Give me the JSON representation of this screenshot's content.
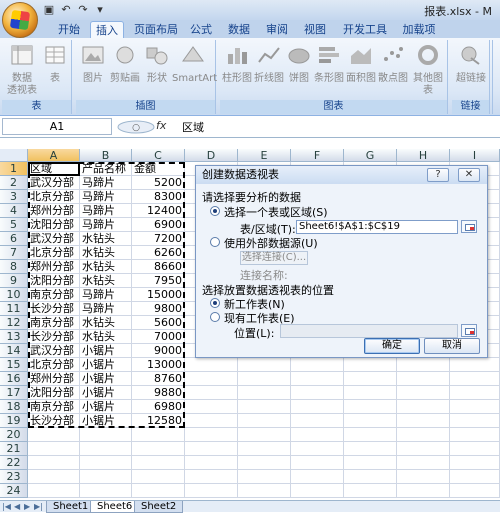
{
  "window": {
    "title": "报表.xlsx - M"
  },
  "qat": {
    "save_icon": "save-icon",
    "undo_icon": "undo-icon",
    "redo_icon": "redo-icon"
  },
  "ribbon_tabs": [
    "开始",
    "插入",
    "页面布局",
    "公式",
    "数据",
    "审阅",
    "视图",
    "开发工具",
    "加载项"
  ],
  "active_tab": "插入",
  "ribbon": {
    "groups": [
      {
        "label": "表",
        "buttons": [
          "数据\n透视表",
          "表"
        ]
      },
      {
        "label": "插图",
        "buttons": [
          "图片",
          "剪贴画",
          "形状",
          "SmartArt"
        ]
      },
      {
        "label": "图表",
        "buttons": [
          "柱形图",
          "折线图",
          "饼图",
          "条形图",
          "面积图",
          "散点图",
          "其他图表"
        ]
      },
      {
        "label": "链接",
        "buttons": [
          "超链接"
        ]
      }
    ]
  },
  "formula_bar": {
    "name_box": "A1",
    "fx": "fx",
    "formula": "区域"
  },
  "columns": [
    "A",
    "B",
    "C",
    "D",
    "E",
    "F",
    "G",
    "H",
    "I"
  ],
  "rows": [
    "1",
    "2",
    "3",
    "4",
    "5",
    "6",
    "7",
    "8",
    "9",
    "10",
    "11",
    "12",
    "13",
    "14",
    "15",
    "16",
    "17",
    "18",
    "19",
    "20",
    "21",
    "22",
    "23",
    "24"
  ],
  "table": [
    [
      "区域",
      "产品名称",
      "金额"
    ],
    [
      "武汉分部",
      "马蹄片",
      "5200"
    ],
    [
      "北京分部",
      "马蹄片",
      "8300"
    ],
    [
      "郑州分部",
      "马蹄片",
      "12400"
    ],
    [
      "沈阳分部",
      "马蹄片",
      "6900"
    ],
    [
      "武汉分部",
      "水钻头",
      "7200"
    ],
    [
      "北京分部",
      "水钻头",
      "6260"
    ],
    [
      "郑州分部",
      "水钻头",
      "8660"
    ],
    [
      "沈阳分部",
      "水钻头",
      "7950"
    ],
    [
      "南京分部",
      "马蹄片",
      "15000"
    ],
    [
      "长沙分部",
      "马蹄片",
      "9800"
    ],
    [
      "南京分部",
      "水钻头",
      "5600"
    ],
    [
      "长沙分部",
      "水钻头",
      "7000"
    ],
    [
      "武汉分部",
      "小锯片",
      "9000"
    ],
    [
      "北京分部",
      "小锯片",
      "13000"
    ],
    [
      "郑州分部",
      "小锯片",
      "8760"
    ],
    [
      "沈阳分部",
      "小锯片",
      "9880"
    ],
    [
      "南京分部",
      "小锯片",
      "6980"
    ],
    [
      "长沙分部",
      "小锯片",
      "12580"
    ]
  ],
  "sheets": [
    "Sheet1",
    "Sheet6",
    "Sheet2"
  ],
  "active_sheet": "Sheet6",
  "dialog": {
    "title": "创建数据透视表",
    "help": "?",
    "close": "✕",
    "section1": "请选择要分析的数据",
    "opt_select_table": "选择一个表或区域(S)",
    "table_range_label": "表/区域(T):",
    "table_range_value": "Sheet6!$A$1:$C$19",
    "opt_external": "使用外部数据源(U)",
    "choose_connection": "选择连接(C)...",
    "connection_name": "连接名称:",
    "section2": "选择放置数据透视表的位置",
    "opt_new_sheet": "新工作表(N)",
    "opt_existing_sheet": "现有工作表(E)",
    "location_label": "位置(L):",
    "location_value": "",
    "ok": "确定",
    "cancel": "取消"
  }
}
